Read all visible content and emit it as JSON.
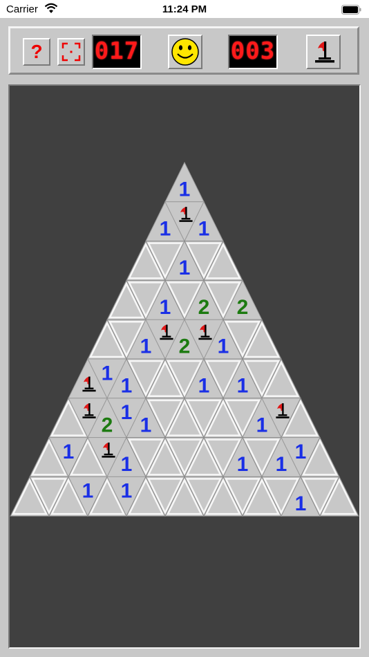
{
  "status_bar": {
    "carrier": "Carrier",
    "time": "11:24 PM"
  },
  "toolbar": {
    "help_label": "?",
    "mines_remaining_display": "017",
    "elapsed_time_display": "003",
    "face_state": "smiley",
    "mode_icon": "flag-icon"
  },
  "board": {
    "shape": "triangle",
    "rows": 9,
    "columns_per_row": [
      1,
      3,
      5,
      7,
      9,
      11,
      13,
      15,
      17
    ],
    "cells": [
      {
        "row": 0,
        "col": 0,
        "state": "revealed",
        "value": "1"
      },
      {
        "row": 1,
        "col": 0,
        "state": "revealed",
        "value": "1"
      },
      {
        "row": 1,
        "col": 1,
        "state": "flagged",
        "value": ""
      },
      {
        "row": 1,
        "col": 2,
        "state": "revealed",
        "value": "1"
      },
      {
        "row": 2,
        "col": 2,
        "state": "revealed",
        "value": "1"
      },
      {
        "row": 3,
        "col": 2,
        "state": "revealed",
        "value": "1"
      },
      {
        "row": 3,
        "col": 4,
        "state": "revealed",
        "value": "2"
      },
      {
        "row": 3,
        "col": 6,
        "state": "revealed",
        "value": "2"
      },
      {
        "row": 4,
        "col": 2,
        "state": "revealed",
        "value": "1"
      },
      {
        "row": 4,
        "col": 3,
        "state": "flagged",
        "value": ""
      },
      {
        "row": 4,
        "col": 4,
        "state": "revealed",
        "value": "2"
      },
      {
        "row": 4,
        "col": 5,
        "state": "flagged",
        "value": ""
      },
      {
        "row": 4,
        "col": 6,
        "state": "revealed",
        "value": "1"
      },
      {
        "row": 5,
        "col": 0,
        "state": "flagged",
        "value": ""
      },
      {
        "row": 5,
        "col": 1,
        "state": "revealed",
        "value": "1"
      },
      {
        "row": 5,
        "col": 2,
        "state": "revealed",
        "value": "1"
      },
      {
        "row": 5,
        "col": 6,
        "state": "revealed",
        "value": "1"
      },
      {
        "row": 5,
        "col": 8,
        "state": "revealed",
        "value": "1"
      },
      {
        "row": 6,
        "col": 1,
        "state": "flagged",
        "value": ""
      },
      {
        "row": 6,
        "col": 2,
        "state": "revealed",
        "value": "2"
      },
      {
        "row": 6,
        "col": 3,
        "state": "revealed",
        "value": "1"
      },
      {
        "row": 6,
        "col": 4,
        "state": "revealed",
        "value": "1"
      },
      {
        "row": 6,
        "col": 10,
        "state": "revealed",
        "value": "1"
      },
      {
        "row": 6,
        "col": 11,
        "state": "flagged",
        "value": ""
      },
      {
        "row": 7,
        "col": 1,
        "state": "revealed",
        "value": "1"
      },
      {
        "row": 7,
        "col": 3,
        "state": "flagged",
        "value": ""
      },
      {
        "row": 7,
        "col": 4,
        "state": "revealed",
        "value": "1"
      },
      {
        "row": 7,
        "col": 10,
        "state": "revealed",
        "value": "1"
      },
      {
        "row": 7,
        "col": 12,
        "state": "revealed",
        "value": "1"
      },
      {
        "row": 7,
        "col": 13,
        "state": "revealed",
        "value": "1"
      },
      {
        "row": 8,
        "col": 3,
        "state": "revealed",
        "value": "1"
      },
      {
        "row": 8,
        "col": 5,
        "state": "revealed",
        "value": "1"
      },
      {
        "row": 8,
        "col": 14,
        "state": "revealed",
        "value": "1"
      }
    ]
  },
  "colors": {
    "number_1": "#1a2fe6",
    "number_2": "#1c7a10",
    "flag": "#e01818",
    "lcd_digits": "#ff1a1a",
    "cell_face": "#c8c8c8",
    "board_background": "#404040"
  }
}
